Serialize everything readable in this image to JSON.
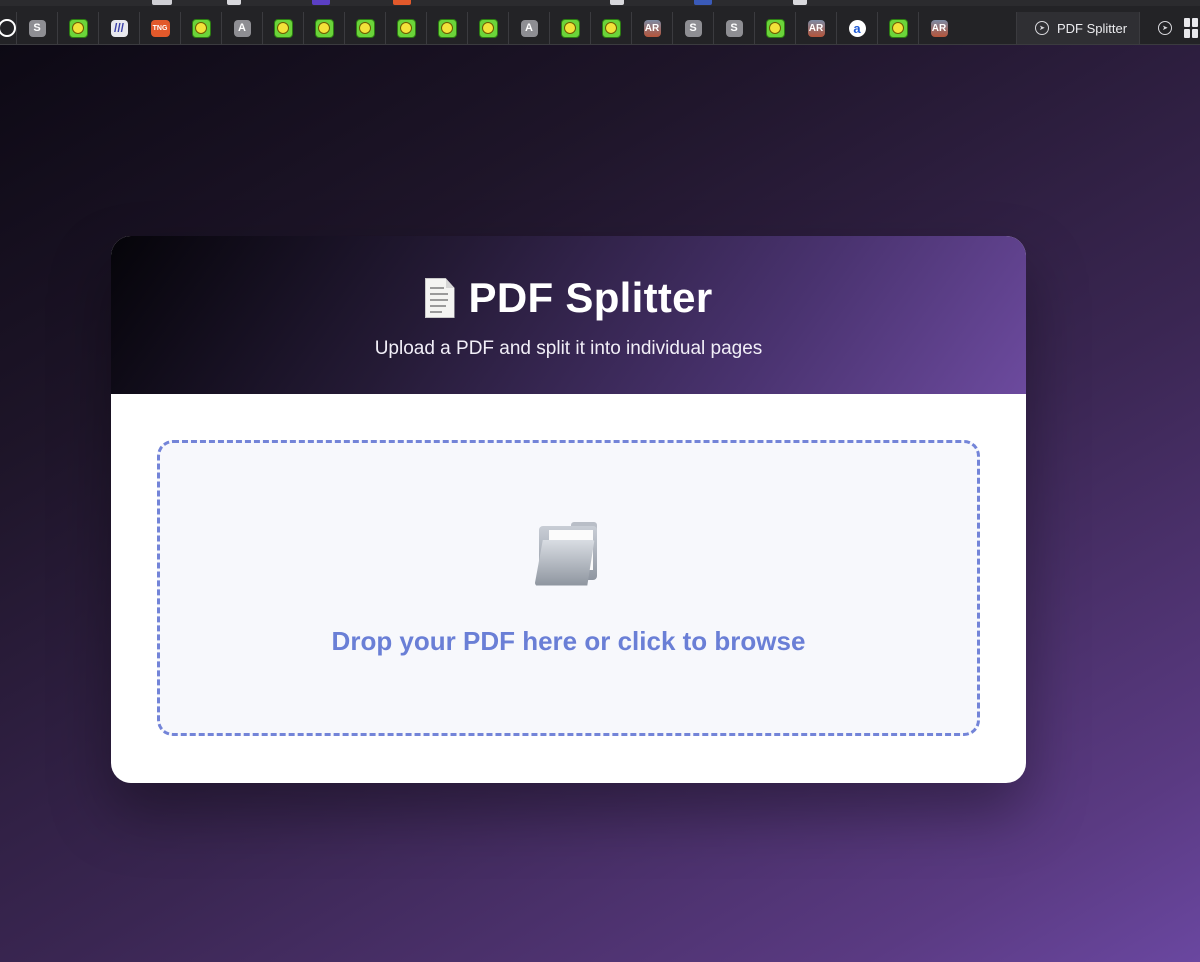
{
  "browser": {
    "pinned_tabs": [
      {
        "icon": "safari-pinned-icon",
        "label": ""
      },
      {
        "icon": "letter-s-icon",
        "label": "S"
      },
      {
        "icon": "smiley-icon",
        "label": ""
      },
      {
        "icon": "bars-logo-icon",
        "label": "///"
      },
      {
        "icon": "tng-logo-icon",
        "label": "TNG"
      },
      {
        "icon": "smiley-icon",
        "label": ""
      },
      {
        "icon": "letter-a-icon",
        "label": "A"
      },
      {
        "icon": "smiley-icon",
        "label": ""
      },
      {
        "icon": "smiley-icon",
        "label": ""
      },
      {
        "icon": "smiley-icon",
        "label": ""
      },
      {
        "icon": "smiley-icon",
        "label": ""
      },
      {
        "icon": "smiley-icon",
        "label": ""
      },
      {
        "icon": "smiley-icon",
        "label": ""
      },
      {
        "icon": "letter-a-icon",
        "label": "A"
      },
      {
        "icon": "smiley-icon",
        "label": ""
      },
      {
        "icon": "smiley-icon",
        "label": ""
      },
      {
        "icon": "ar-logo-icon",
        "label": "AR"
      },
      {
        "icon": "letter-s-icon",
        "label": "S"
      },
      {
        "icon": "letter-s-icon",
        "label": "S"
      },
      {
        "icon": "smiley-icon",
        "label": ""
      },
      {
        "icon": "ar-logo-icon",
        "label": "AR"
      },
      {
        "icon": "round-a-icon",
        "label": "a"
      },
      {
        "icon": "smiley-icon",
        "label": ""
      },
      {
        "icon": "ar-logo-icon",
        "label": "AR"
      }
    ],
    "active_tab": {
      "title": "PDF Splitter",
      "icon": "compass-icon"
    }
  },
  "header": {
    "title": "PDF Splitter",
    "subtitle": "Upload a PDF and split it into individual pages",
    "icon": "document-icon"
  },
  "dropzone": {
    "icon": "folder-icon",
    "text": "Drop your PDF here or click to browse"
  },
  "colors": {
    "accent": "#6a7fd6",
    "border": "#7384d8",
    "dropzone_bg": "#f7f8fc"
  }
}
